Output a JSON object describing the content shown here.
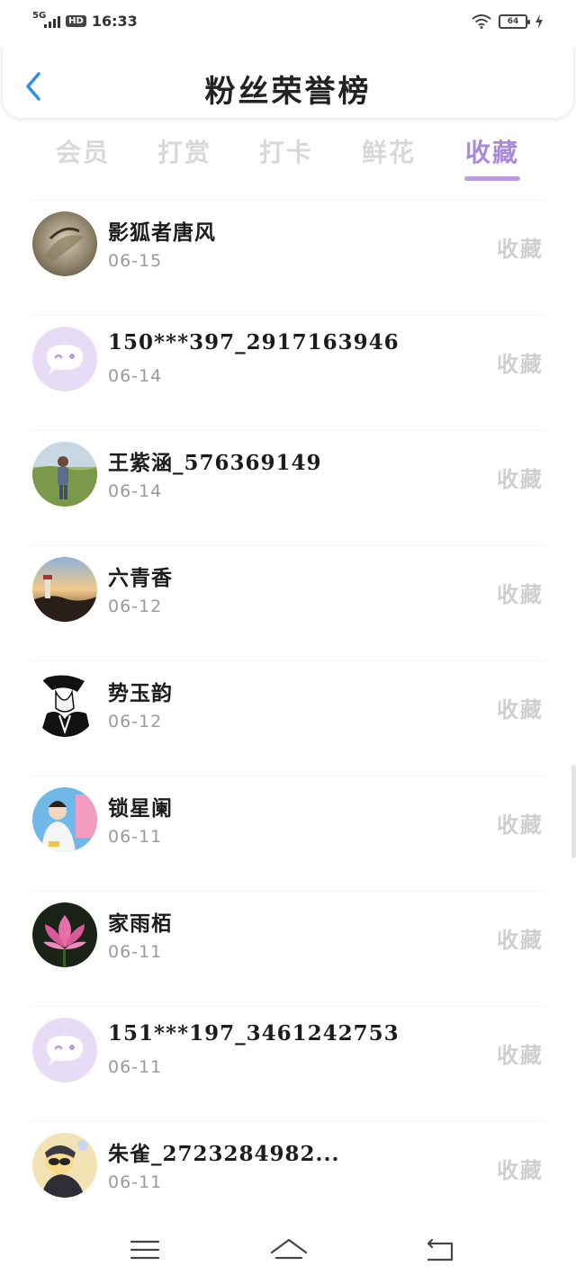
{
  "status_bar": {
    "network": "5G",
    "hd": "HD",
    "time": "16:33",
    "battery": "64"
  },
  "header": {
    "title": "粉丝荣誉榜"
  },
  "tabs": [
    {
      "label": "会员",
      "active": false
    },
    {
      "label": "打赏",
      "active": false
    },
    {
      "label": "打卡",
      "active": false
    },
    {
      "label": "鲜花",
      "active": false
    },
    {
      "label": "收藏",
      "active": true
    }
  ],
  "fans": [
    {
      "name": "影狐者唐风",
      "date": "06-15",
      "status": "收藏",
      "avatar": "photo-bird"
    },
    {
      "name": "150***397_2917163946",
      "date": "06-14",
      "status": "收藏",
      "avatar": "default-chat"
    },
    {
      "name": "王紫涵_576369149",
      "date": "06-14",
      "status": "收藏",
      "avatar": "photo-person-outdoor"
    },
    {
      "name": "六青香",
      "date": "06-12",
      "status": "收藏",
      "avatar": "photo-lighthouse"
    },
    {
      "name": "势玉韵",
      "date": "06-12",
      "status": "收藏",
      "avatar": "photo-sketch"
    },
    {
      "name": "锁星阑",
      "date": "06-11",
      "status": "收藏",
      "avatar": "photo-child"
    },
    {
      "name": "家雨栢",
      "date": "06-11",
      "status": "收藏",
      "avatar": "photo-lotus"
    },
    {
      "name": "151***197_3461242753",
      "date": "06-11",
      "status": "收藏",
      "avatar": "default-chat"
    },
    {
      "name": "朱雀_2723284982...",
      "date": "06-11",
      "status": "收藏",
      "avatar": "photo-cartoon"
    }
  ],
  "colors": {
    "accent": "#a98ad8",
    "back_arrow": "#2f8fe8",
    "tab_inactive": "#d8d8d8",
    "status_text": "#cfcfcf"
  },
  "icons": {
    "back": "chevron-left-icon",
    "nav_menu": "menu-icon",
    "nav_home": "home-icon",
    "nav_back": "back-icon"
  }
}
